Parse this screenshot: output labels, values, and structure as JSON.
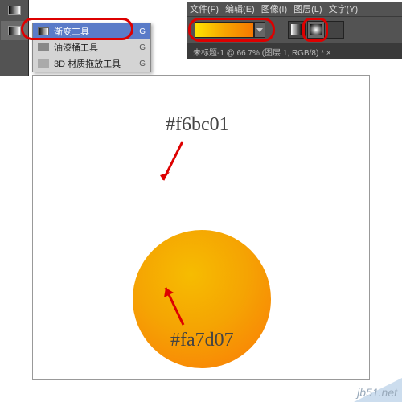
{
  "toolbar": {
    "active_tool": "gradient"
  },
  "flyout": {
    "items": [
      {
        "label": "渐变工具",
        "key": "G",
        "selected": true,
        "icon": "gradient"
      },
      {
        "label": "油漆桶工具",
        "key": "G",
        "selected": false,
        "icon": "bucket"
      },
      {
        "label": "3D 材质拖放工具",
        "key": "G",
        "selected": false,
        "icon": "3d"
      }
    ]
  },
  "menubar": {
    "items": [
      "文件(F)",
      "编辑(E)",
      "图像(I)",
      "图层(L)",
      "文字(Y)"
    ]
  },
  "tabbar": {
    "text": "未标题-1 @ 66.7% (图层 1, RGB/8) * ×"
  },
  "annotations": {
    "color_top": "#f6bc01",
    "color_bottom": "#fa7d07"
  },
  "gradient": {
    "start": "#f6bc01",
    "end": "#fa7d07"
  },
  "watermark": "jb51.net"
}
